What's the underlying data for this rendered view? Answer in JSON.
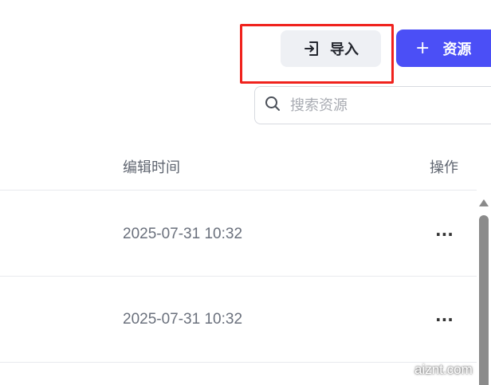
{
  "toolbar": {
    "import_label": "导入",
    "add_resource_label": "资源",
    "add_icon": "plus-icon",
    "import_icon": "import-icon"
  },
  "search": {
    "placeholder": "搜索资源",
    "value": "",
    "icon": "search-icon"
  },
  "table": {
    "columns": [
      "编辑时间",
      "操作"
    ],
    "rows": [
      {
        "edit_time": "2025-07-31 10:32",
        "action": "···"
      },
      {
        "edit_time": "2025-07-31 10:32",
        "action": "···"
      }
    ]
  },
  "watermark": "aiznt.com",
  "colors": {
    "primary": "#4b4ff6",
    "highlight": "#f0221d",
    "import_bg": "#eef0f4"
  }
}
